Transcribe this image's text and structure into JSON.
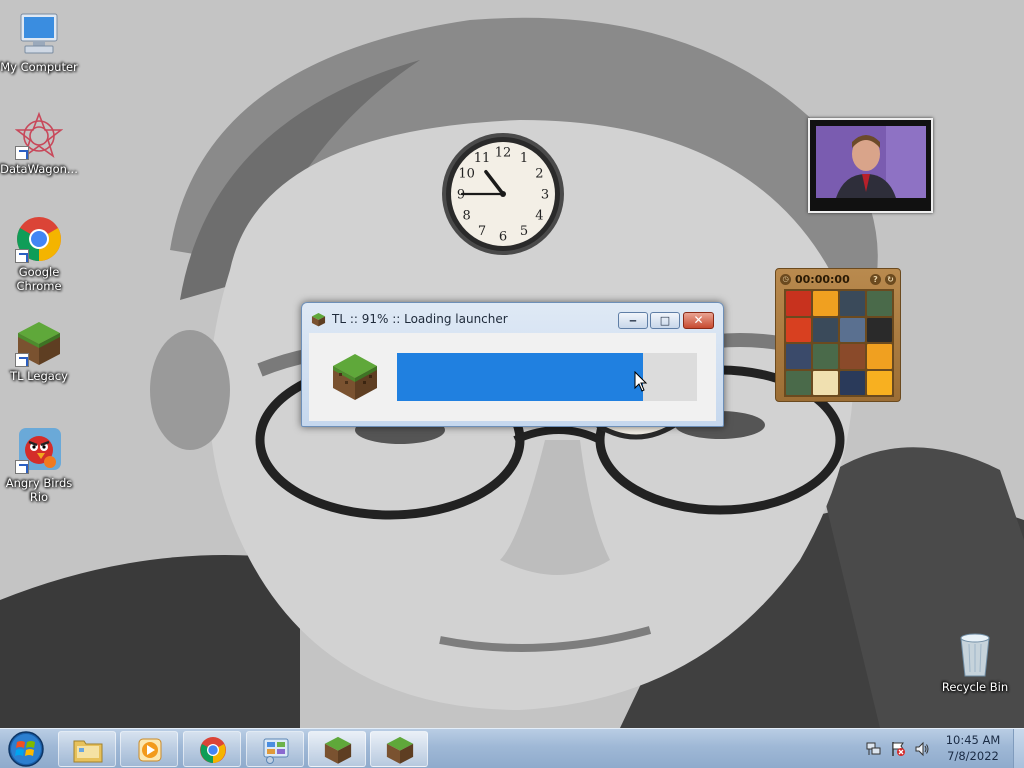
{
  "desktop": {
    "icons": [
      {
        "label": "My Computer",
        "icon": "computer-icon"
      },
      {
        "label": "DataWagon...",
        "icon": "datawagon-icon"
      },
      {
        "label": "Google Chrome",
        "icon": "chrome-icon"
      },
      {
        "label": "TL Legacy",
        "icon": "grass-block-icon"
      },
      {
        "label": "Angry Birds Rio",
        "icon": "angry-birds-icon"
      }
    ],
    "recycle_bin": {
      "label": "Recycle Bin",
      "icon": "recycle-bin-icon"
    }
  },
  "gadgets": {
    "clock": {
      "hour": 10,
      "minute": 45
    },
    "puzzle": {
      "timer": "00:00:00",
      "help_label": "?",
      "shuffle_label": "↻",
      "tiles": [
        "#c8321e",
        "#f0a020",
        "#3a4a5a",
        "#4a6a4a",
        "#d84020",
        "#3a4a5a",
        "#5a7090",
        "#2a2a2a",
        "#3a4a6a",
        "#4a6a4a",
        "#8a4a2a",
        "#f0a020",
        "#4a6a4a",
        "#f0e0b0",
        "#2a3a5a",
        "#f8b020"
      ]
    }
  },
  "loader_window": {
    "title": "TL :: 91% :: Loading launcher",
    "progress": 0.82,
    "minimize_glyph": "‒",
    "maximize_glyph": "□",
    "close_glyph": "✕"
  },
  "taskbar": {
    "buttons": [
      {
        "name": "file-explorer",
        "icon": "folder-icon"
      },
      {
        "name": "media-player",
        "icon": "media-player-icon"
      },
      {
        "name": "chrome",
        "icon": "chrome-icon"
      },
      {
        "name": "control-panel",
        "icon": "control-panel-icon"
      },
      {
        "name": "tl-legacy-1",
        "icon": "grass-block-icon"
      },
      {
        "name": "tl-legacy-2",
        "icon": "grass-block-icon"
      }
    ],
    "time": "10:45 AM",
    "date": "7/8/2022"
  },
  "colors": {
    "accent_progress": "#2080e0",
    "taskbar": "#9fb8d6"
  }
}
